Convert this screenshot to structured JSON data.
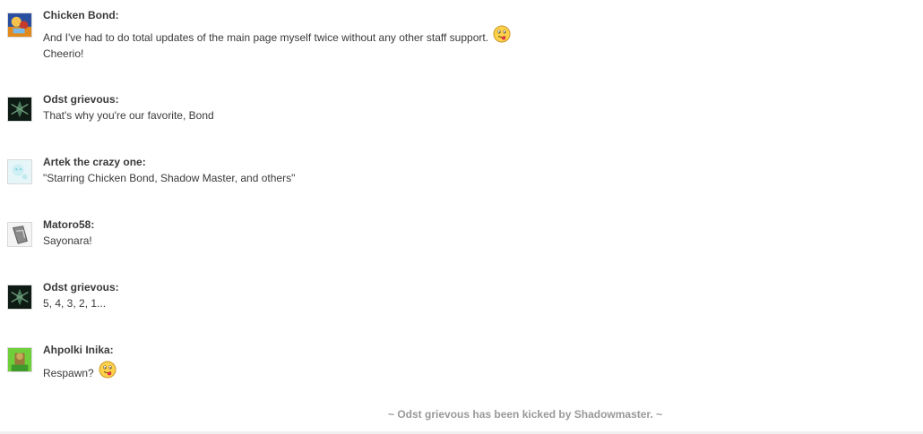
{
  "messages": [
    {
      "user": "Chicken Bond:",
      "avatar_icon": "chicken-bond-avatar",
      "lines": [
        "And I've had to do total updates of the main page myself twice without any other staff support.",
        "Cheerio!"
      ],
      "emoticon": "tongue-out-smiley-icon"
    },
    {
      "user": "Odst grievous:",
      "avatar_icon": "odst-grievous-avatar",
      "lines": [
        "That's why you're our favorite, Bond"
      ]
    },
    {
      "user": "Artek the crazy one:",
      "avatar_icon": "artek-avatar",
      "lines": [
        "\"Starring Chicken Bond, Shadow Master, and others\""
      ]
    },
    {
      "user": "Matoro58:",
      "avatar_icon": "matoro58-avatar",
      "lines": [
        "Sayonara!"
      ]
    },
    {
      "user": "Odst grievous:",
      "avatar_icon": "odst-grievous-avatar",
      "lines": [
        "5, 4, 3, 2, 1..."
      ]
    },
    {
      "user": "Ahpolki Inika:",
      "avatar_icon": "ahpolki-inika-avatar",
      "lines": [
        "Respawn?"
      ],
      "emoticon": "tongue-out-smiley-icon"
    }
  ],
  "system_message": "~ Odst grievous has been kicked by Shadowmaster. ~",
  "colors": {
    "text": "#3a3a3a",
    "system_text": "#999999"
  }
}
